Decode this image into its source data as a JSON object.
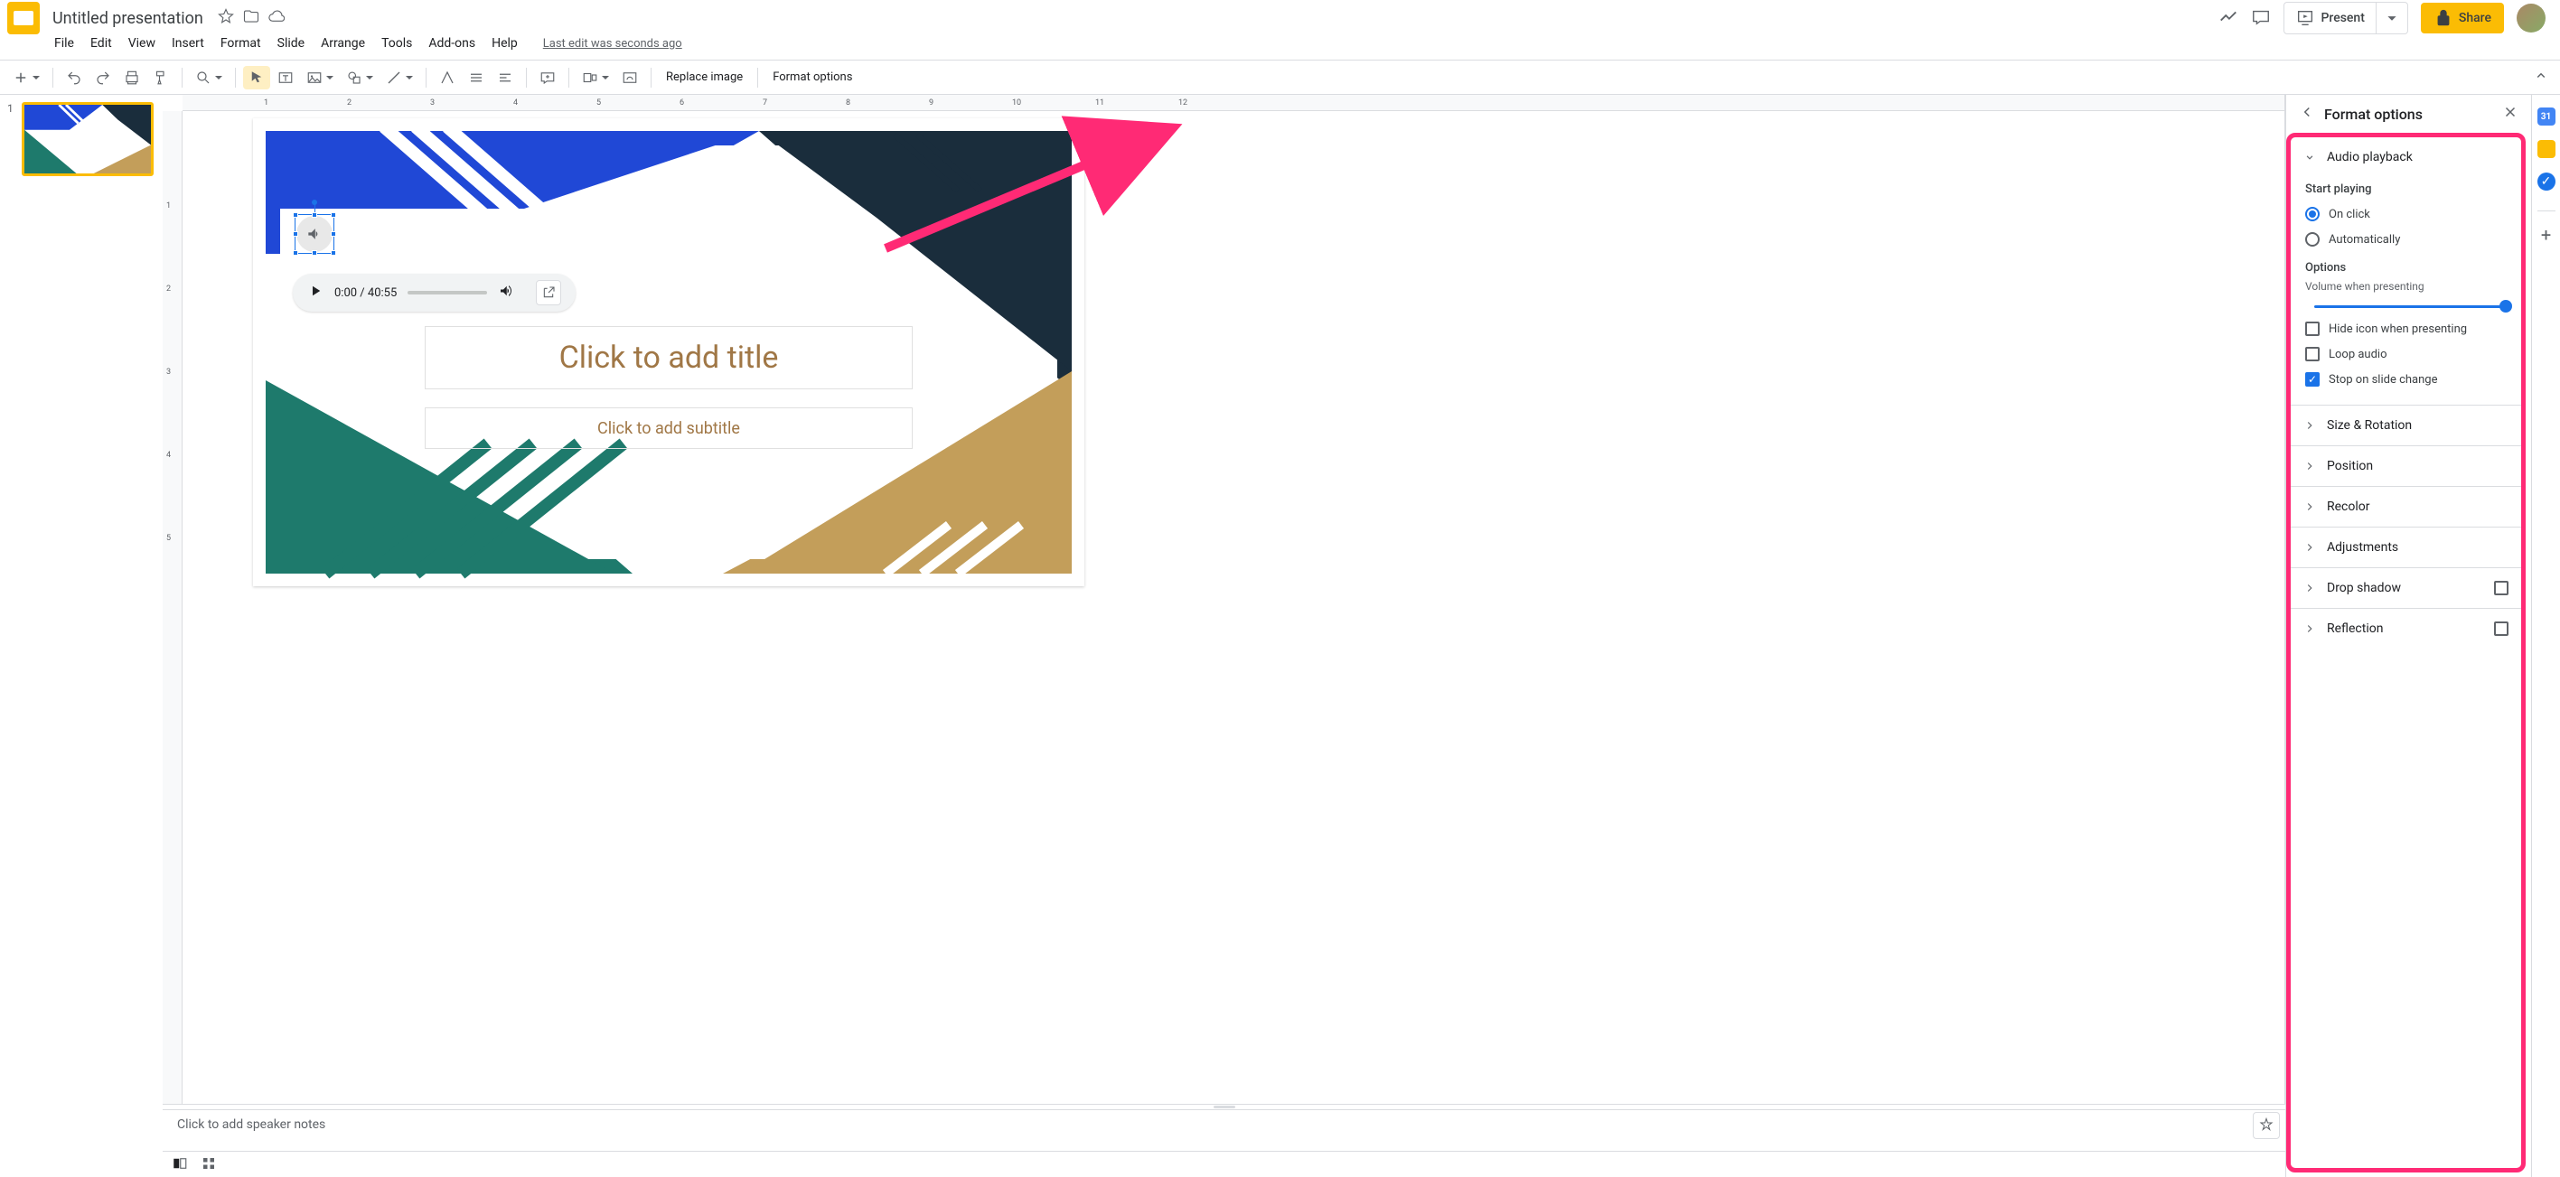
{
  "header": {
    "doc_title": "Untitled presentation",
    "last_edit": "Last edit was seconds ago",
    "present_label": "Present",
    "share_label": "Share"
  },
  "menus": [
    "File",
    "Edit",
    "View",
    "Insert",
    "Format",
    "Slide",
    "Arrange",
    "Tools",
    "Add-ons",
    "Help"
  ],
  "secondary_toolbar": {
    "replace_image": "Replace image",
    "format_options": "Format options"
  },
  "ruler_h_ticks": [
    "1",
    "2",
    "3",
    "4",
    "5",
    "6",
    "7",
    "8",
    "9",
    "10",
    "11",
    "12"
  ],
  "ruler_v_ticks": [
    "1",
    "2",
    "3",
    "4",
    "5"
  ],
  "slide": {
    "number": "1",
    "title_placeholder": "Click to add title",
    "subtitle_placeholder": "Click to add subtitle"
  },
  "audio_player": {
    "current": "0:00",
    "total": "40:55"
  },
  "notes_placeholder": "Click to add speaker notes",
  "format_panel": {
    "title": "Format options",
    "sections": {
      "audio": {
        "title": "Audio playback",
        "start_label": "Start playing",
        "on_click": "On click",
        "automatically": "Automatically",
        "options_label": "Options",
        "volume_label": "Volume when presenting",
        "hide_icon": "Hide icon when presenting",
        "loop": "Loop audio",
        "stop_on_change": "Stop on slide change",
        "state": {
          "start_mode": "on_click",
          "volume": 100,
          "hide_icon": false,
          "loop": false,
          "stop_on_change": true
        }
      },
      "size_rotation": "Size & Rotation",
      "position": "Position",
      "recolor": "Recolor",
      "adjustments": "Adjustments",
      "drop_shadow": "Drop shadow",
      "reflection": "Reflection"
    }
  },
  "colors": {
    "highlight": "#ff2a75",
    "share": "#fbbc04",
    "blue": "#1a73e8"
  }
}
